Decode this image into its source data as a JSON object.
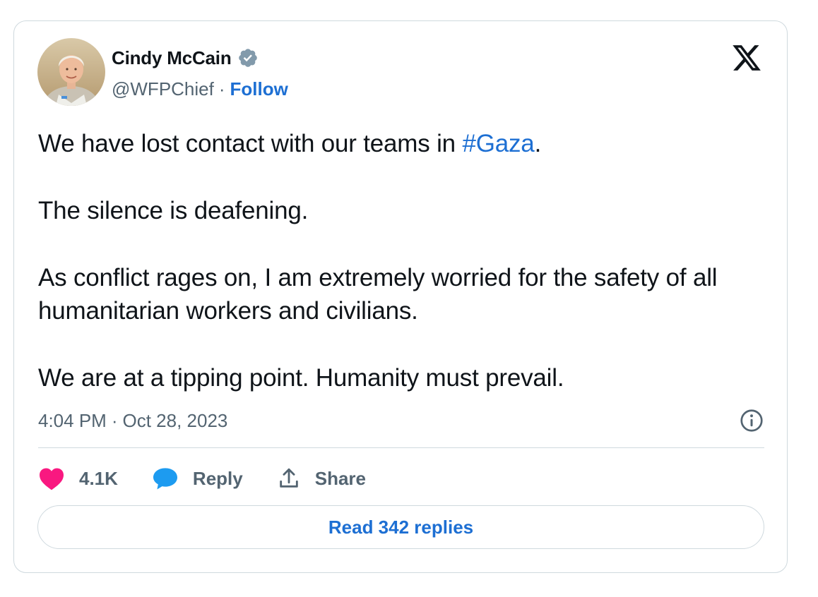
{
  "author": {
    "name": "Cindy McCain",
    "handle": "@WFPChief",
    "separator": "·",
    "follow_label": "Follow",
    "verified": true
  },
  "tweet": {
    "line1_before": "We have lost contact with our teams in ",
    "hashtag": "#Gaza",
    "line1_after": ".",
    "paragraph2": "The silence is deafening.",
    "paragraph3": "As conflict rages on, I am extremely worried for the safety of all humanitarian workers and civilians.",
    "paragraph4": "We are at a tipping point. Humanity must prevail."
  },
  "meta": {
    "time": "4:04 PM",
    "separator": "·",
    "date": "Oct 28, 2023"
  },
  "actions": {
    "likes": "4.1K",
    "reply_label": "Reply",
    "share_label": "Share"
  },
  "footer": {
    "read_replies_label": "Read 342 replies"
  },
  "icons": {
    "verified": "verified-badge-icon",
    "logo": "x-logo-icon",
    "info": "info-icon",
    "like": "heart-icon",
    "reply": "speech-bubble-icon",
    "share": "share-upload-icon"
  },
  "colors": {
    "link": "#1d6fd3",
    "secondary_text": "#536471",
    "heart": "#f91880",
    "reply_bubble": "#1d9bf0",
    "border": "#cfd9de"
  }
}
